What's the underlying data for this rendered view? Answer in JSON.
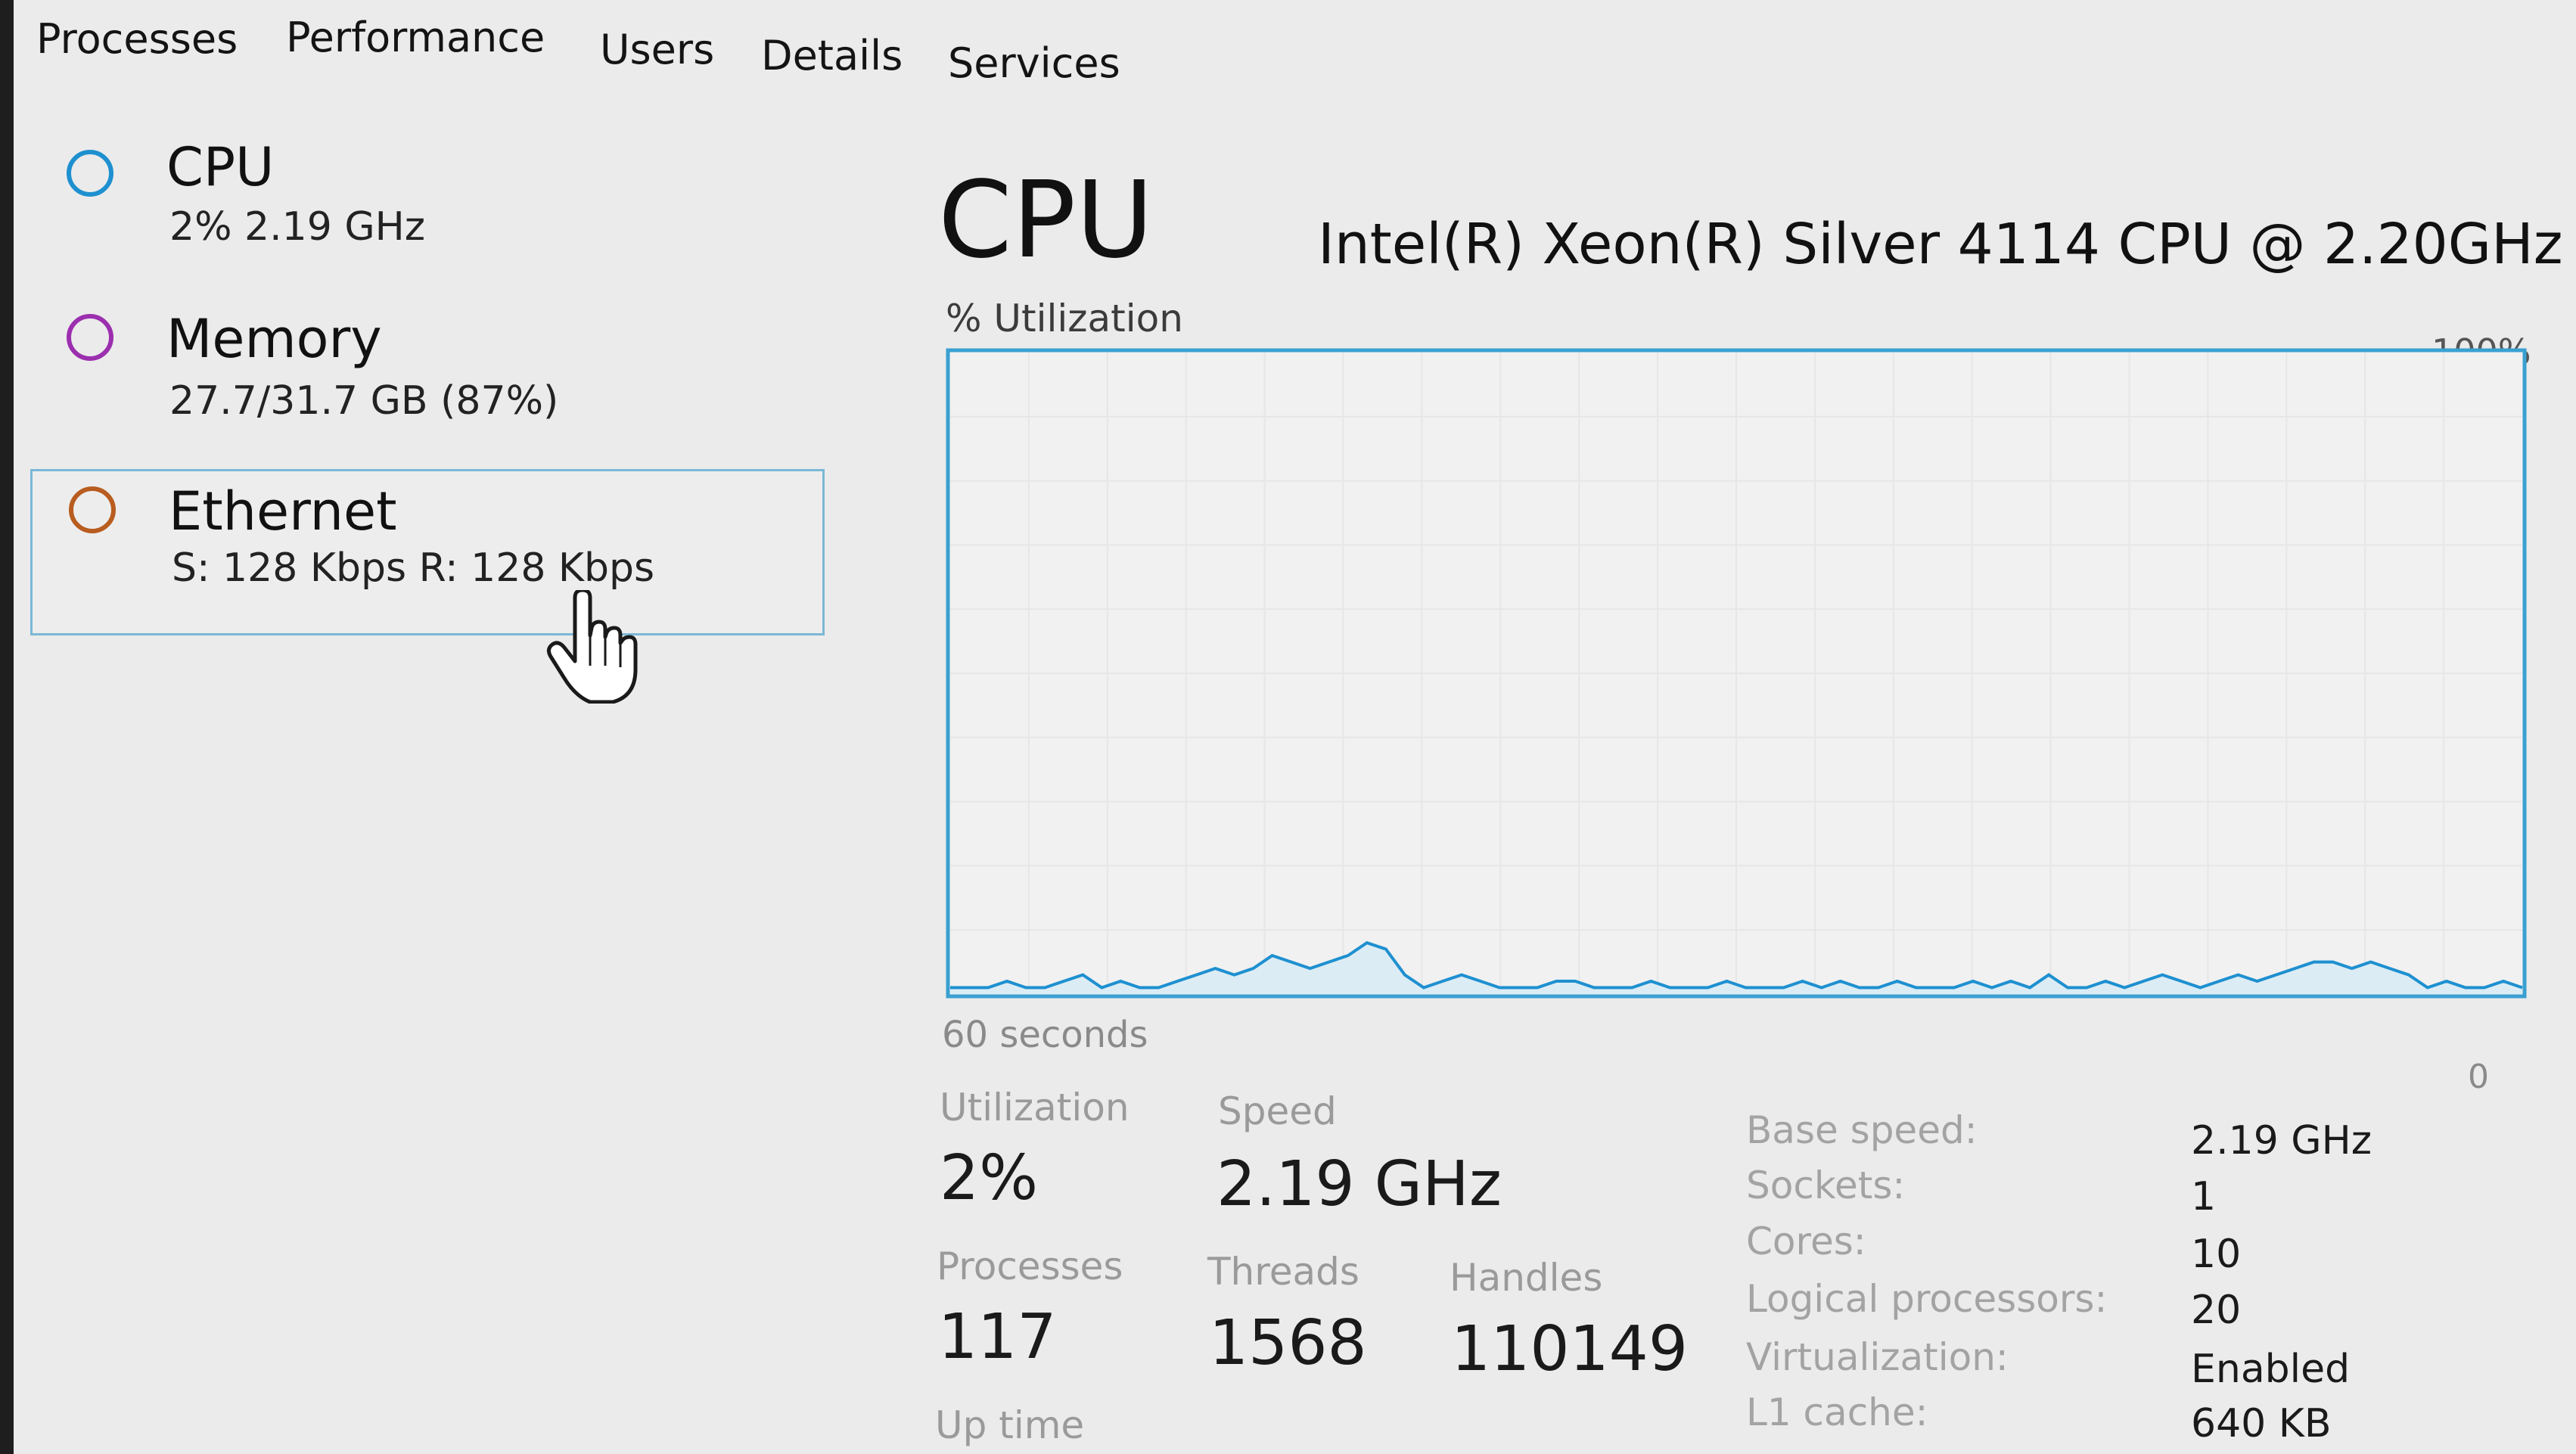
{
  "tabs": [
    "Processes",
    "Performance",
    "Users",
    "Details",
    "Services"
  ],
  "sidebar": {
    "items": [
      {
        "label": "CPU",
        "sub": "2% 2.19 GHz",
        "color": "#1e90d0"
      },
      {
        "label": "Memory",
        "sub": "27.7/31.7 GB (87%)",
        "color": "#9b2fae"
      },
      {
        "label": "Ethernet",
        "sub": "S: 128 Kbps R: 128 Kbps",
        "color": "#b85c1f"
      }
    ]
  },
  "main": {
    "title": "CPU",
    "model": "Intel(R) Xeon(R) Silver 4114 CPU @ 2.20GHz",
    "graph": {
      "y_label": "% Utilization",
      "y_max_label": "100%",
      "x_label": "60 seconds",
      "y_min_label": "0",
      "line_color": "#1e90d0",
      "values": [
        1,
        1,
        1,
        2,
        1,
        1,
        2,
        3,
        1,
        2,
        1,
        1,
        2,
        3,
        4,
        3,
        4,
        6,
        5,
        4,
        5,
        6,
        8,
        7,
        3,
        1,
        2,
        3,
        2,
        1,
        1,
        1,
        2,
        2,
        1,
        1,
        1,
        2,
        1,
        1,
        1,
        2,
        1,
        1,
        1,
        2,
        1,
        2,
        1,
        1,
        2,
        1,
        1,
        1,
        2,
        1,
        2,
        1,
        3,
        1,
        1,
        2,
        1,
        2,
        3,
        2,
        1,
        2,
        3,
        2,
        3,
        4,
        5,
        5,
        4,
        5,
        4,
        3,
        1,
        2,
        1,
        1,
        2,
        1
      ]
    },
    "stats": {
      "utilization": {
        "label": "Utilization",
        "value": "2%"
      },
      "speed": {
        "label": "Speed",
        "value": "2.19 GHz"
      },
      "processes": {
        "label": "Processes",
        "value": "117"
      },
      "threads": {
        "label": "Threads",
        "value": "1568"
      },
      "handles": {
        "label": "Handles",
        "value": "110149"
      },
      "uptime": {
        "label": "Up time"
      }
    },
    "specs": [
      {
        "label": "Base speed:",
        "value": "2.19 GHz"
      },
      {
        "label": "Sockets:",
        "value": "1"
      },
      {
        "label": "Cores:",
        "value": "10"
      },
      {
        "label": "Logical processors:",
        "value": "20"
      },
      {
        "label": "Virtualization:",
        "value": "Enabled"
      },
      {
        "label": "L1 cache:",
        "value": "640 KB"
      }
    ]
  }
}
